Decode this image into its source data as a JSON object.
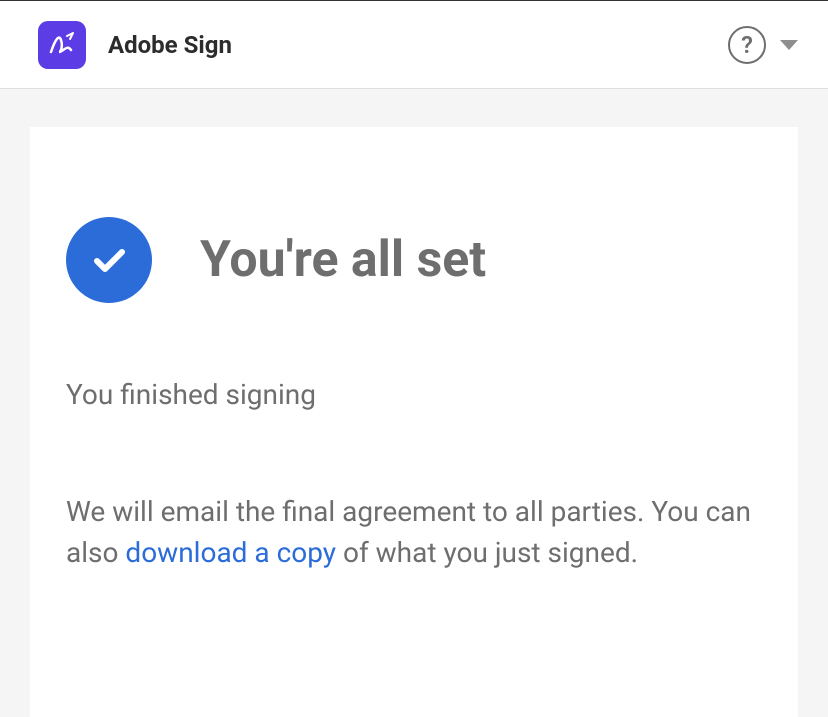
{
  "header": {
    "app_title": "Adobe Sign",
    "help_symbol": "?"
  },
  "main": {
    "hero_title": "You're all set",
    "status_text": "You finished signing",
    "info_before": "We will email the final agreement to all parties. You can also ",
    "download_link": "download a copy",
    "info_after": " of what you just signed."
  }
}
